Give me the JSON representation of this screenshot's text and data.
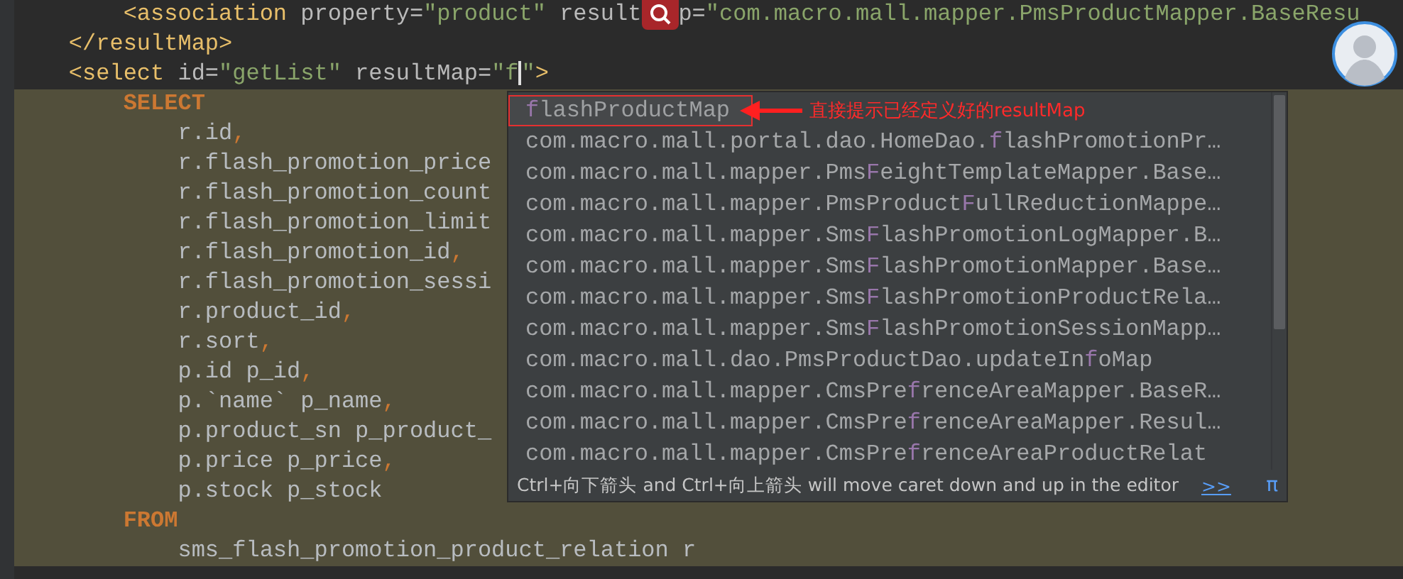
{
  "editor": {
    "lines": [
      {
        "sql_region": false,
        "tokens": [
          {
            "kind": "tag",
            "text": "        <association "
          },
          {
            "kind": "attr",
            "text": "property="
          },
          {
            "kind": "value",
            "text": "\"product\" "
          },
          {
            "kind": "attr",
            "text": "result"
          },
          {
            "kind": "search_button"
          },
          {
            "kind": "attr",
            "text": "p="
          },
          {
            "kind": "value",
            "text": "\"com.macro.mall.mapper.PmsProductMapper.BaseResu"
          }
        ]
      },
      {
        "sql_region": false,
        "tokens": [
          {
            "kind": "tag",
            "text": "    </resultMap>"
          }
        ]
      },
      {
        "sql_region": false,
        "tokens": [
          {
            "kind": "tag",
            "text": "    <select "
          },
          {
            "kind": "attr",
            "text": "id="
          },
          {
            "kind": "value",
            "text": "\"getList\" "
          },
          {
            "kind": "attr",
            "text": "resultMap="
          },
          {
            "kind": "value",
            "text": "\"f"
          },
          {
            "kind": "caret"
          },
          {
            "kind": "value",
            "text": "\""
          },
          {
            "kind": "tag",
            "text": ">"
          }
        ]
      },
      {
        "sql_region": true,
        "tokens": [
          {
            "kind": "keyword",
            "text": "        SELECT"
          }
        ]
      },
      {
        "sql_region": true,
        "tokens": [
          {
            "kind": "ident",
            "text": "            r.id"
          },
          {
            "kind": "punct",
            "text": ","
          }
        ]
      },
      {
        "sql_region": true,
        "tokens": [
          {
            "kind": "ident",
            "text": "            r.flash_promotion_price"
          }
        ]
      },
      {
        "sql_region": true,
        "tokens": [
          {
            "kind": "ident",
            "text": "            r.flash_promotion_count"
          }
        ]
      },
      {
        "sql_region": true,
        "tokens": [
          {
            "kind": "ident",
            "text": "            r.flash_promotion_limit"
          }
        ]
      },
      {
        "sql_region": true,
        "tokens": [
          {
            "kind": "ident",
            "text": "            r.flash_promotion_id"
          },
          {
            "kind": "punct",
            "text": ","
          }
        ]
      },
      {
        "sql_region": true,
        "tokens": [
          {
            "kind": "ident",
            "text": "            r.flash_promotion_sessi"
          }
        ]
      },
      {
        "sql_region": true,
        "tokens": [
          {
            "kind": "ident",
            "text": "            r.product_id"
          },
          {
            "kind": "punct",
            "text": ","
          }
        ]
      },
      {
        "sql_region": true,
        "tokens": [
          {
            "kind": "ident",
            "text": "            r.sort"
          },
          {
            "kind": "punct",
            "text": ","
          }
        ]
      },
      {
        "sql_region": true,
        "tokens": [
          {
            "kind": "ident",
            "text": "            p.id p_id"
          },
          {
            "kind": "punct",
            "text": ","
          }
        ]
      },
      {
        "sql_region": true,
        "tokens": [
          {
            "kind": "ident",
            "text": "            p.`name` p_name"
          },
          {
            "kind": "punct",
            "text": ","
          }
        ]
      },
      {
        "sql_region": true,
        "tokens": [
          {
            "kind": "ident",
            "text": "            p.product_sn p_product_"
          }
        ]
      },
      {
        "sql_region": true,
        "tokens": [
          {
            "kind": "ident",
            "text": "            p.price p_price"
          },
          {
            "kind": "punct",
            "text": ","
          }
        ]
      },
      {
        "sql_region": true,
        "tokens": [
          {
            "kind": "ident",
            "text": "            p.stock p_stock"
          }
        ]
      },
      {
        "sql_region": true,
        "tokens": [
          {
            "kind": "keyword",
            "text": "        FROM"
          }
        ]
      },
      {
        "sql_region": true,
        "tokens": [
          {
            "kind": "ident",
            "text": "            sms_flash_promotion_product_relation r"
          }
        ]
      }
    ]
  },
  "completion": {
    "items": [
      {
        "selected": true,
        "match": "f",
        "after": "lashProductMap"
      },
      {
        "selected": false,
        "before": "com.macro.mall.portal.dao.HomeDao.",
        "match": "f",
        "after": "lashPromotionPr…"
      },
      {
        "selected": false,
        "before": "com.macro.mall.mapper.Pms",
        "match": "F",
        "after": "eightTemplateMapper.Base…"
      },
      {
        "selected": false,
        "before": "com.macro.mall.mapper.PmsProduct",
        "match": "F",
        "after": "ullReductionMappe…"
      },
      {
        "selected": false,
        "before": "com.macro.mall.mapper.Sms",
        "match": "F",
        "after": "lashPromotionLogMapper.B…"
      },
      {
        "selected": false,
        "before": "com.macro.mall.mapper.Sms",
        "match": "F",
        "after": "lashPromotionMapper.Base…"
      },
      {
        "selected": false,
        "before": "com.macro.mall.mapper.Sms",
        "match": "F",
        "after": "lashPromotionProductRela…"
      },
      {
        "selected": false,
        "before": "com.macro.mall.mapper.Sms",
        "match": "F",
        "after": "lashPromotionSessionMapp…"
      },
      {
        "selected": false,
        "before": "com.macro.mall.dao.PmsProductDao.updateIn",
        "match": "f",
        "after": "oMap"
      },
      {
        "selected": false,
        "before": "com.macro.mall.mapper.CmsPre",
        "match": "f",
        "after": "renceAreaMapper.BaseR…"
      },
      {
        "selected": false,
        "before": "com.macro.mall.mapper.CmsPre",
        "match": "f",
        "after": "renceAreaMapper.Resul…"
      },
      {
        "selected": false,
        "before": "com.macro.mall.mapper.CmsPre",
        "match": "f",
        "after": "renceAreaProductRelat"
      }
    ],
    "hint": "Ctrl+向下箭头 and Ctrl+向上箭头 will move caret down and up in the editor",
    "hint_link": ">>",
    "pi": "π"
  },
  "annotation": {
    "text": "直接提示已经定义好的resultMap"
  }
}
